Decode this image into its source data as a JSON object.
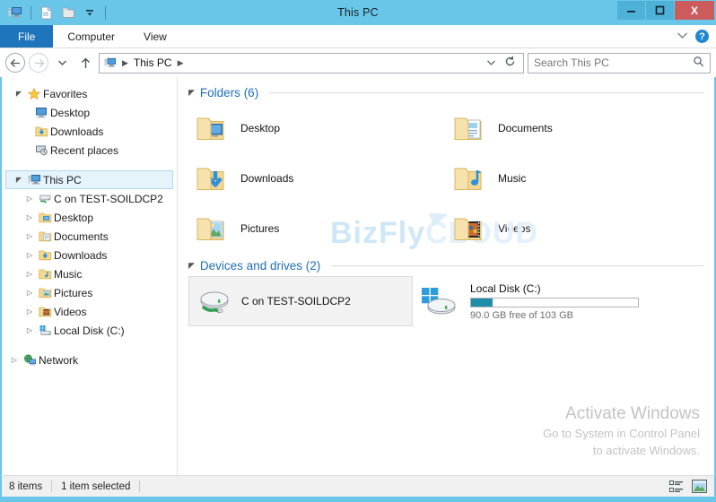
{
  "window": {
    "title": "This PC",
    "minimize_label": "–",
    "maximize_label": "□",
    "close_label": "X"
  },
  "quick_access": {
    "items": [
      {
        "name": "this-pc-icon",
        "label": "This PC"
      },
      {
        "name": "properties-icon",
        "label": "Properties"
      },
      {
        "name": "new-folder-icon",
        "label": "New folder"
      },
      {
        "name": "customize-dropdown-icon",
        "label": "Customize Quick Access Toolbar"
      }
    ]
  },
  "ribbon": {
    "tabs": [
      {
        "label": "File",
        "active": true
      },
      {
        "label": "Computer",
        "active": false
      },
      {
        "label": "View",
        "active": false
      }
    ],
    "expand_label": "⌄",
    "help_label": "?"
  },
  "addressbar": {
    "back_label": "←",
    "forward_label": "→",
    "recent_label": "▾",
    "up_label": "↑",
    "path_root_icon": "this-pc-icon",
    "crumbs": [
      "This PC"
    ],
    "dropdown_label": "∨",
    "refresh_label": "↻",
    "search_placeholder": "Search This PC",
    "search_value": ""
  },
  "sidebar": {
    "groups": [
      {
        "label": "Favorites",
        "icon": "star-icon",
        "expanded": true,
        "selected": false,
        "children": [
          {
            "label": "Desktop",
            "icon": "desktop-icon"
          },
          {
            "label": "Downloads",
            "icon": "downloads-folder-icon"
          },
          {
            "label": "Recent places",
            "icon": "recent-places-icon"
          }
        ]
      },
      {
        "label": "This PC",
        "icon": "this-pc-icon",
        "expanded": true,
        "selected": true,
        "children": [
          {
            "label": "C on TEST-SOILDCP2",
            "icon": "network-drive-icon"
          },
          {
            "label": "Desktop",
            "icon": "desktop-folder-icon"
          },
          {
            "label": "Documents",
            "icon": "documents-folder-icon"
          },
          {
            "label": "Downloads",
            "icon": "downloads-folder-icon"
          },
          {
            "label": "Music",
            "icon": "music-folder-icon"
          },
          {
            "label": "Pictures",
            "icon": "pictures-folder-icon"
          },
          {
            "label": "Videos",
            "icon": "videos-folder-icon"
          },
          {
            "label": "Local Disk (C:)",
            "icon": "local-disk-icon"
          }
        ]
      },
      {
        "label": "Network",
        "icon": "network-icon",
        "expanded": false,
        "selected": false,
        "children": []
      }
    ]
  },
  "content": {
    "folders_group": {
      "title": "Folders (6)",
      "items": [
        {
          "label": "Desktop",
          "icon": "desktop-folder-icon"
        },
        {
          "label": "Documents",
          "icon": "documents-folder-icon"
        },
        {
          "label": "Downloads",
          "icon": "downloads-folder-icon"
        },
        {
          "label": "Music",
          "icon": "music-folder-icon"
        },
        {
          "label": "Pictures",
          "icon": "pictures-folder-icon"
        },
        {
          "label": "Videos",
          "icon": "videos-folder-icon"
        }
      ]
    },
    "drives_group": {
      "title": "Devices and drives (2)",
      "items": [
        {
          "label": "C on TEST-SOILDCP2",
          "icon": "network-drive-icon",
          "selected": true,
          "has_bar": false
        },
        {
          "label": "Local Disk (C:)",
          "icon": "windows-local-disk-icon",
          "selected": false,
          "has_bar": true,
          "capacity_text": "90.0 GB free of 103 GB",
          "used_percent": 13,
          "bar_color": "#1F8CA8"
        }
      ]
    }
  },
  "watermarks": {
    "brand_part1": "BizFly",
    "brand_part2": "CLOUD",
    "activate_title": "Activate Windows",
    "activate_line1": "Go to System in Control Panel",
    "activate_line2": "to activate Windows."
  },
  "statusbar": {
    "item_count": "8 items",
    "selection_text": "1 item selected",
    "details_view_label": "Details view",
    "large_icons_view_label": "Large icons view"
  },
  "colors": {
    "titlebar": "#6AC6E8",
    "file_tab": "#1E75BB",
    "close_button": "#CC5C5C",
    "group_header": "#1E6FB8",
    "selection": "#E5F3FB",
    "progress": "#1F8CA8"
  }
}
